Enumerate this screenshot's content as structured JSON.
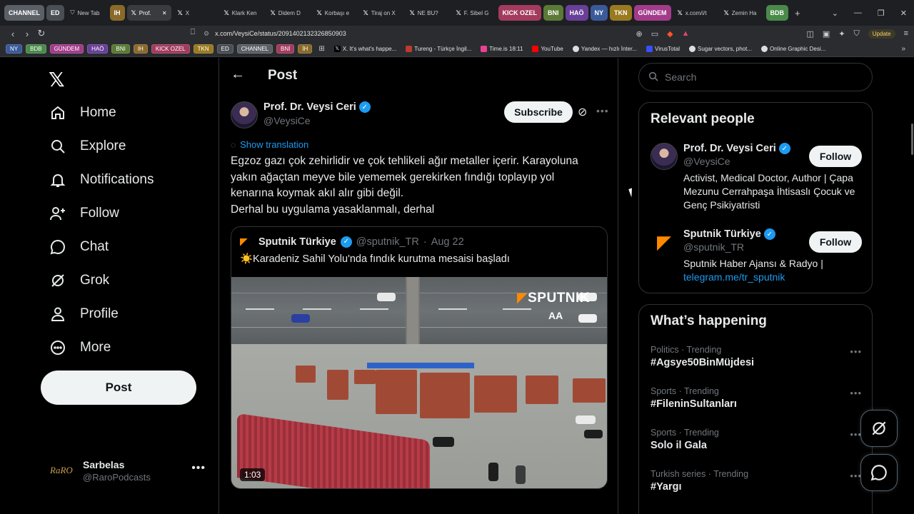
{
  "browser": {
    "tabs": [
      {
        "label": "CHANNEL",
        "type": "group",
        "color": "#5b5f66"
      },
      {
        "label": "ED",
        "type": "group",
        "color": "#4a4f56"
      },
      {
        "label": "New Tab",
        "type": "page",
        "icon": "shield-icon"
      },
      {
        "label": "IH",
        "type": "group",
        "color": "#8a6a2a"
      },
      {
        "label": "Prof.",
        "type": "page",
        "icon": "x-icon",
        "active": true,
        "closable": true
      },
      {
        "label": "X",
        "type": "page",
        "icon": "x-icon",
        "closable": true
      },
      {
        "label": "Klark Ken",
        "type": "page",
        "icon": "x-icon"
      },
      {
        "label": "Didem D",
        "type": "page",
        "icon": "x-icon"
      },
      {
        "label": "Korbaşı e",
        "type": "page",
        "icon": "x-icon"
      },
      {
        "label": "Tiraj on X",
        "type": "page",
        "icon": "x-icon"
      },
      {
        "label": "NE BU?",
        "type": "page",
        "icon": "x-icon"
      },
      {
        "label": "F. Sibel G",
        "type": "page",
        "icon": "x-icon"
      },
      {
        "label": "KICK OZEL",
        "type": "group",
        "color": "#a33b5e"
      },
      {
        "label": "BNI",
        "type": "group",
        "color": "#5a7a35"
      },
      {
        "label": "HAÖ",
        "type": "group",
        "color": "#6a3f9a"
      },
      {
        "label": "NY",
        "type": "group",
        "color": "#3a5a9a"
      },
      {
        "label": "TKN",
        "type": "group",
        "color": "#9a7a20"
      },
      {
        "label": "GÜNDEM",
        "type": "group",
        "color": "#a33b8a"
      },
      {
        "label": "x.com/i/t",
        "type": "page",
        "icon": "x-icon"
      },
      {
        "label": "Zemin Ha",
        "type": "page",
        "icon": "x-icon"
      },
      {
        "label": "BDB",
        "type": "group",
        "color": "#4a8a4a"
      }
    ],
    "url": "x.com/VeysiCe/status/2091402132326850903",
    "update_label": "Update",
    "bookmark_groups": [
      {
        "label": "NY",
        "color": "#3a5a9a"
      },
      {
        "label": "BDB",
        "color": "#4a8a4a"
      },
      {
        "label": "GÜNDEM",
        "color": "#a33b8a"
      },
      {
        "label": "HAÖ",
        "color": "#6a3f9a"
      },
      {
        "label": "BNI",
        "color": "#5a7a35"
      },
      {
        "label": "IH",
        "color": "#8a6a2a"
      },
      {
        "label": "KICK OZEL",
        "color": "#a33b5e"
      },
      {
        "label": "TKN",
        "color": "#9a7a20"
      },
      {
        "label": "ED",
        "color": "#4a4f56"
      },
      {
        "label": "CHANNEL",
        "color": "#5b5f66"
      },
      {
        "label": "BNİ",
        "color": "#a33b5e"
      },
      {
        "label": "İH",
        "color": "#8a6a2a"
      }
    ],
    "bookmark_links": [
      {
        "label": "X. It's what's happe...",
        "color": "#000000"
      },
      {
        "label": "Tureng - Türkçe İngil...",
        "color": "#c0392b"
      },
      {
        "label": "Time.is 18:11",
        "color": "#e84393"
      },
      {
        "label": "YouTube",
        "color": "#ff0000"
      },
      {
        "label": "Yandex — hızlı İnter...",
        "color": "#eeeeee"
      },
      {
        "label": "VirusTotal",
        "color": "#394eff"
      },
      {
        "label": "Sugar vectors, phot...",
        "color": "#eeeeee"
      },
      {
        "label": "Online Graphic Desi...",
        "color": "#eeeeee"
      }
    ]
  },
  "nav": {
    "items": [
      {
        "label": "Home",
        "icon": "home-icon"
      },
      {
        "label": "Explore",
        "icon": "search-icon"
      },
      {
        "label": "Notifications",
        "icon": "bell-icon"
      },
      {
        "label": "Follow",
        "icon": "add-user-icon"
      },
      {
        "label": "Chat",
        "icon": "chat-icon"
      },
      {
        "label": "Grok",
        "icon": "grok-icon"
      },
      {
        "label": "Profile",
        "icon": "profile-icon"
      },
      {
        "label": "More",
        "icon": "more-circle-icon"
      }
    ],
    "post_label": "Post"
  },
  "account": {
    "name": "Sarbelas",
    "handle": "@RaroPodcasts",
    "logo_text": "RaRO"
  },
  "main": {
    "title": "Post",
    "author": {
      "name": "Prof. Dr. Veysi Ceri",
      "handle": "@VeysiCe"
    },
    "subscribe_label": "Subscribe",
    "translate_label": "Show translation",
    "text_lines": [
      "Egzoz gazı çok zehirlidir ve çok tehlikeli ağır metaller içerir. Karayoluna",
      "yakın ağaçtan meyve bile yememek gerekirken fındığı toplayıp yol",
      "kenarına koymak akıl alır gibi değil.",
      "Derhal bu uygulama yasaklanmalı, derhal"
    ],
    "quote": {
      "name": "Sputnik Türkiye",
      "handle": "@sputnik_TR",
      "date": "Aug 22",
      "text": "☀️Karadeniz Sahil Yolu'nda fındık kurutma mesaisi başladı",
      "watermark": "SPUTNIK",
      "watermark2": "AA",
      "duration": "1:03"
    }
  },
  "right": {
    "search_placeholder": "Search",
    "relevant_title": "Relevant people",
    "people": [
      {
        "name": "Prof. Dr. Veysi Ceri",
        "handle": "@VeysiCe",
        "bio": "Activist, Medical Doctor, Author | Çapa Mezunu Cerrahpaşa İhtisaslı Çocuk ve Genç Psikiyatristi",
        "follow_label": "Follow"
      },
      {
        "name": "Sputnik Türkiye",
        "handle": "@sputnik_TR",
        "bio": "Sputnik Haber Ajansı & Radyo |",
        "link": "telegram.me/tr_sputnik",
        "follow_label": "Follow"
      }
    ],
    "happening_title": "What’s happening",
    "trends": [
      {
        "meta": "Politics · Trending",
        "name": "#Agsye50BinMüjdesi"
      },
      {
        "meta": "Sports · Trending",
        "name": "#FileninSultanları"
      },
      {
        "meta": "Sports · Trending",
        "name": "Solo il Gala"
      },
      {
        "meta": "Turkish series · Trending",
        "name": "#Yargı"
      }
    ]
  },
  "colors": {
    "accent": "#1d9bf0",
    "sputnik": "#ff8a00",
    "bg": "#000000",
    "border": "#2f3336"
  }
}
